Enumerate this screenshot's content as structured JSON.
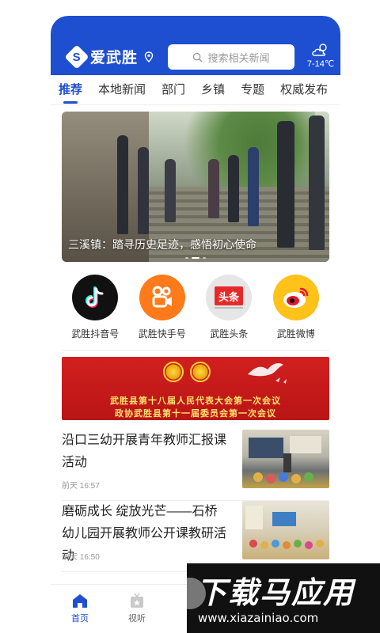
{
  "header": {
    "brand": "爱武胜",
    "brand_mark": "S",
    "search_placeholder": "搜索相关新闻",
    "weather_temp": "7-14℃",
    "weather_icon": "partly-cloudy-icon"
  },
  "tabs": [
    {
      "label": "推荐",
      "active": true
    },
    {
      "label": "本地新闻",
      "active": false
    },
    {
      "label": "部门",
      "active": false
    },
    {
      "label": "乡镇",
      "active": false
    },
    {
      "label": "专题",
      "active": false
    },
    {
      "label": "权威发布",
      "active": false
    }
  ],
  "banner": {
    "caption": "三溪镇：踏寻历史足迹，感悟初心使命",
    "dots": 3,
    "active_dot": 1
  },
  "apps": [
    {
      "label": "武胜抖音号",
      "icon": "tiktok-icon",
      "color": "#111111"
    },
    {
      "label": "武胜快手号",
      "icon": "kuaishou-icon",
      "color": "#ff7a1a"
    },
    {
      "label": "武胜头条",
      "icon": "toutiao-icon",
      "color": "#e8e8e8"
    },
    {
      "label": "武胜微博",
      "icon": "weibo-icon",
      "color": "#ffc21a"
    }
  ],
  "promo": {
    "line1": "武胜县第十八届人民代表大会第一次会议",
    "line2": "政协武胜县第十一届委员会第一次会议"
  },
  "news": [
    {
      "title": "沿口三幼开展青年教师汇报课活动",
      "time": "前天 16:57"
    },
    {
      "title": "磨砺成长 绽放光芒——石桥幼儿园开展教师公开课教研活动",
      "time": "前天 16:50"
    }
  ],
  "tabbar": {
    "home": "首页",
    "listen": "视听"
  },
  "watermark": {
    "title": "下载马应用",
    "url": "www.xiazainiao.com"
  },
  "colors": {
    "primary": "#1f4fd1",
    "promo_red": "#c91a1a",
    "promo_text": "#ffe36a"
  }
}
